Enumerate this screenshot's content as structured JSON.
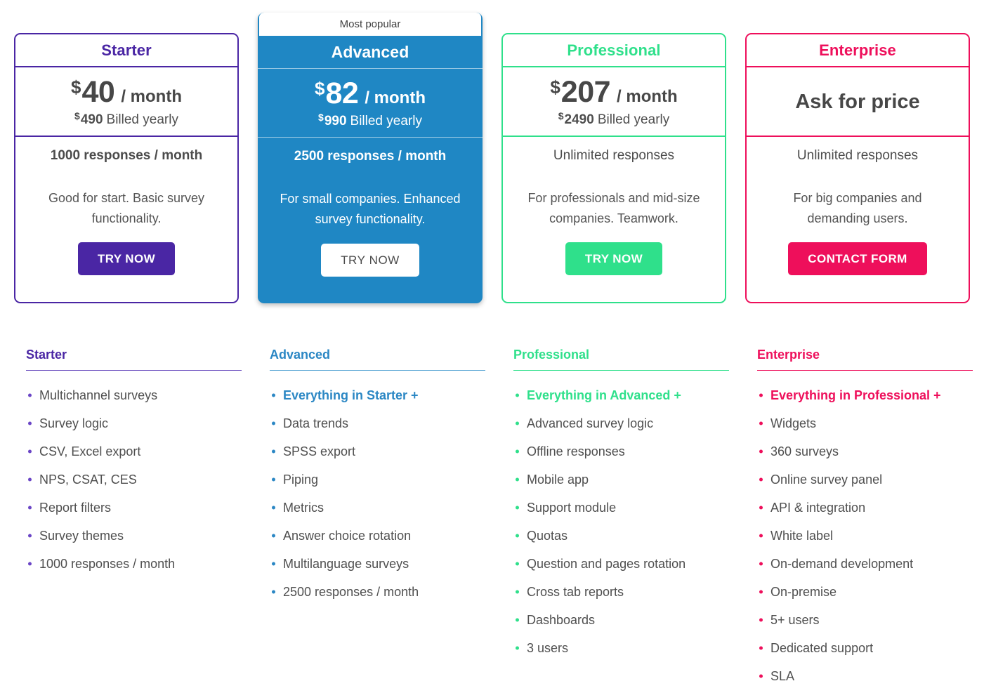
{
  "colors": {
    "starter": "#4a26a4",
    "advanced": "#1f87c4",
    "professional": "#2fe08b",
    "enterprise": "#ee0f5b",
    "text": "#4f4f4f"
  },
  "badge": {
    "most_popular": "Most popular"
  },
  "plans": [
    {
      "name": "Starter",
      "currency": "$",
      "price": "40",
      "per": "/ month",
      "yearly_currency": "$",
      "yearly_price": "490",
      "yearly_label": "Billed yearly",
      "responses": "1000 responses / month",
      "description": "Good for start. Basic survey functionality.",
      "cta": "TRY NOW"
    },
    {
      "name": "Advanced",
      "currency": "$",
      "price": "82",
      "per": "/ month",
      "yearly_currency": "$",
      "yearly_price": "990",
      "yearly_label": "Billed yearly",
      "responses": "2500 responses / month",
      "description": "For small companies. Enhanced survey functionality.",
      "cta": "TRY NOW"
    },
    {
      "name": "Professional",
      "currency": "$",
      "price": "207",
      "per": "/ month",
      "yearly_currency": "$",
      "yearly_price": "2490",
      "yearly_label": "Billed yearly",
      "responses": "Unlimited responses",
      "description": "For professionals and mid-size companies. Teamwork.",
      "cta": "TRY NOW"
    },
    {
      "name": "Enterprise",
      "price_text": "Ask for price",
      "responses": "Unlimited responses",
      "description": "For big companies and demanding users.",
      "cta": "CONTACT FORM"
    }
  ],
  "feature_columns": [
    {
      "title": "Starter",
      "items": [
        {
          "label": "Multichannel surveys",
          "highlight": false
        },
        {
          "label": "Survey logic",
          "highlight": false
        },
        {
          "label": "CSV, Excel export",
          "highlight": false
        },
        {
          "label": "NPS, CSAT, CES",
          "highlight": false
        },
        {
          "label": "Report filters",
          "highlight": false
        },
        {
          "label": "Survey themes",
          "highlight": false
        },
        {
          "label": "1000 responses / month",
          "highlight": false
        }
      ]
    },
    {
      "title": "Advanced",
      "items": [
        {
          "label": "Everything in Starter +",
          "highlight": true
        },
        {
          "label": "Data trends",
          "highlight": false
        },
        {
          "label": "SPSS export",
          "highlight": false
        },
        {
          "label": "Piping",
          "highlight": false
        },
        {
          "label": "Metrics",
          "highlight": false
        },
        {
          "label": "Answer choice rotation",
          "highlight": false
        },
        {
          "label": "Multilanguage surveys",
          "highlight": false
        },
        {
          "label": "2500 responses / month",
          "highlight": false
        }
      ]
    },
    {
      "title": "Professional",
      "items": [
        {
          "label": "Everything in Advanced +",
          "highlight": true
        },
        {
          "label": "Advanced survey logic",
          "highlight": false
        },
        {
          "label": "Offline responses",
          "highlight": false
        },
        {
          "label": "Mobile app",
          "highlight": false
        },
        {
          "label": "Support module",
          "highlight": false
        },
        {
          "label": "Quotas",
          "highlight": false
        },
        {
          "label": "Question and pages rotation",
          "highlight": false
        },
        {
          "label": "Cross tab reports",
          "highlight": false
        },
        {
          "label": "Dashboards",
          "highlight": false
        },
        {
          "label": "3 users",
          "highlight": false
        }
      ]
    },
    {
      "title": "Enterprise",
      "items": [
        {
          "label": "Everything in Professional +",
          "highlight": true
        },
        {
          "label": "Widgets",
          "highlight": false
        },
        {
          "label": "360 surveys",
          "highlight": false
        },
        {
          "label": "Online survey panel",
          "highlight": false
        },
        {
          "label": "API & integration",
          "highlight": false
        },
        {
          "label": "White label",
          "highlight": false
        },
        {
          "label": "On-demand development",
          "highlight": false
        },
        {
          "label": "On-premise",
          "highlight": false
        },
        {
          "label": "5+ users",
          "highlight": false
        },
        {
          "label": "Dedicated support",
          "highlight": false
        },
        {
          "label": "SLA",
          "highlight": false
        }
      ]
    }
  ]
}
